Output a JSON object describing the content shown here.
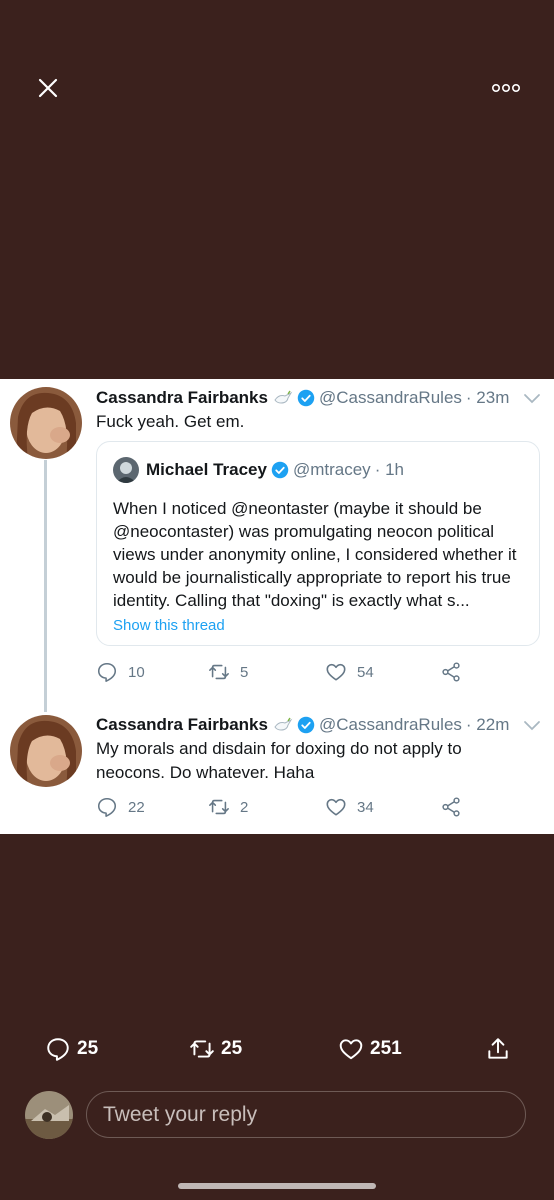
{
  "nav": {
    "close_icon": "close-icon",
    "more_icon": "more-options-icon"
  },
  "thread": [
    {
      "author": "Cassandra Fairbanks",
      "handle": "@CassandraRules",
      "time": "· 23m",
      "text": "Fuck yeah. Get em.",
      "replies": "10",
      "retweets": "5",
      "likes": "54"
    },
    {
      "author": "Cassandra Fairbanks",
      "handle": "@CassandraRules",
      "time": "· 22m",
      "text": "My morals and disdain for doxing do not apply to neocons. Do whatever. Haha",
      "replies": "22",
      "retweets": "2",
      "likes": "34"
    }
  ],
  "quote": {
    "author": "Michael Tracey",
    "handle": "@mtracey",
    "time": "· 1h",
    "text": "When I noticed @neontaster (maybe it should be @neocontaster) was promulgating neocon political views under anonymity online, I considered whether it would be journalistically appropriate to report his true identity. Calling that \"doxing\" is exactly what s...",
    "show_thread": "Show this thread"
  },
  "main_stats": {
    "replies": "25",
    "retweets": "25",
    "likes": "251"
  },
  "reply_box": {
    "placeholder": "Tweet your reply"
  },
  "colors": {
    "background": "#3b211d",
    "card": "#ffffff",
    "link": "#1da1f2",
    "verified": "#1da1f2",
    "muted": "#657786"
  }
}
